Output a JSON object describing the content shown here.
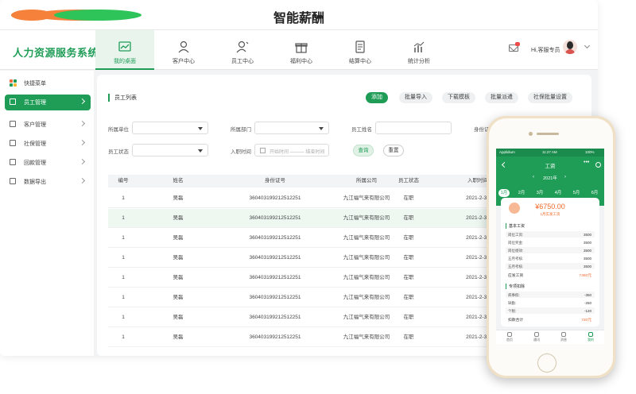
{
  "window": {
    "title": "智能薪酬"
  },
  "brand": "人力资源服务系统",
  "topnav": [
    {
      "label": "我的桌面",
      "icon": "chart-icon",
      "active": true
    },
    {
      "label": "客户中心",
      "icon": "user-icon",
      "active": false
    },
    {
      "label": "员工中心",
      "icon": "user-edit-icon",
      "active": false
    },
    {
      "label": "福利中心",
      "icon": "gift-icon",
      "active": false
    },
    {
      "label": "结算中心",
      "icon": "document-icon",
      "active": false
    },
    {
      "label": "统计分析",
      "icon": "bar-chart-icon",
      "active": false
    }
  ],
  "user": {
    "name": "Hi,客服专员"
  },
  "sidebar": {
    "quick": "快捷菜单",
    "items": [
      {
        "label": "员工管理",
        "icon": "id-card-icon",
        "active": true
      },
      {
        "label": "客户管理",
        "icon": "client-icon",
        "active": false
      },
      {
        "label": "社保管理",
        "icon": "shield-icon",
        "active": false
      },
      {
        "label": "回款管理",
        "icon": "payment-icon",
        "active": false
      },
      {
        "label": "数据导出",
        "icon": "export-icon",
        "active": false
      }
    ]
  },
  "panel": {
    "title": "员工列表",
    "buttons": [
      "添加",
      "批量导入",
      "下载模板",
      "批量派遣",
      "社保批量设置"
    ],
    "filters": {
      "company_label": "所属单位",
      "dept_label": "所属部门",
      "name_label": "员工姓名",
      "idcard_label": "身份证号",
      "status_label": "员工状态",
      "date_label": "入职时间",
      "date_placeholder": "开始时间 ——— 结束时间"
    },
    "search_button": "查询",
    "reset_button": "重置"
  },
  "table": {
    "headers": [
      "编号",
      "姓名",
      "身份证号",
      "所属公司",
      "员工状态",
      "入职时间"
    ],
    "rows": [
      [
        "1",
        "吴磊",
        "360403199212512251",
        "九江福气来有限公司",
        "在职",
        "2021-2-31"
      ],
      [
        "1",
        "吴磊",
        "360403199212512251",
        "九江福气来有限公司",
        "在职",
        "2021-2-31"
      ],
      [
        "1",
        "吴磊",
        "360403199212512251",
        "九江福气来有限公司",
        "在职",
        "2021-2-31"
      ],
      [
        "1",
        "吴磊",
        "360403199212512251",
        "九江福气来有限公司",
        "在职",
        "2021-2-31"
      ],
      [
        "1",
        "吴磊",
        "360403199212512251",
        "九江福气来有限公司",
        "在职",
        "2021-2-31"
      ],
      [
        "1",
        "吴磊",
        "360403199212512251",
        "九江福气来有限公司",
        "在职",
        "2021-2-31"
      ],
      [
        "1",
        "吴磊",
        "360403199212512251",
        "九江福气来有限公司",
        "在职",
        "2021-2-31"
      ],
      [
        "1",
        "吴磊",
        "360403199212512251",
        "九江福气来有限公司",
        "在职",
        "2021-2-31"
      ]
    ]
  },
  "phone": {
    "status": {
      "carrier": "Applidium",
      "time": "11:27 AM",
      "battery": "100%"
    },
    "title": "工资",
    "more": "•••",
    "year": "2021年",
    "months": [
      "1月",
      "2月",
      "3月",
      "4月",
      "5月",
      "6月"
    ],
    "amount": "¥6750.00",
    "amount_sub": "1月实发工资",
    "basic_title": "基本工资",
    "basic_rows": [
      {
        "label": "岗位工资:",
        "value": "3500"
      },
      {
        "label": "岗位奖金:",
        "value": "3500"
      },
      {
        "label": "岗位绩效:",
        "value": "3500"
      },
      {
        "label": "五月考核:",
        "value": "3500"
      },
      {
        "label": "五月考核:",
        "value": "3500"
      }
    ],
    "basic_total_label": "应发工资",
    "basic_total_value": "7450元",
    "deduct_title": "专项扣除",
    "deduct_rows": [
      {
        "label": "病事假:",
        "value": "-350"
      },
      {
        "label": "缺勤:",
        "value": "-250"
      },
      {
        "label": "个税:",
        "value": "-120"
      }
    ],
    "deduct_total_label": "扣款合计",
    "deduct_total_value": "720元",
    "tabs": [
      "首页",
      "通讯",
      "消息",
      "我的"
    ]
  }
}
